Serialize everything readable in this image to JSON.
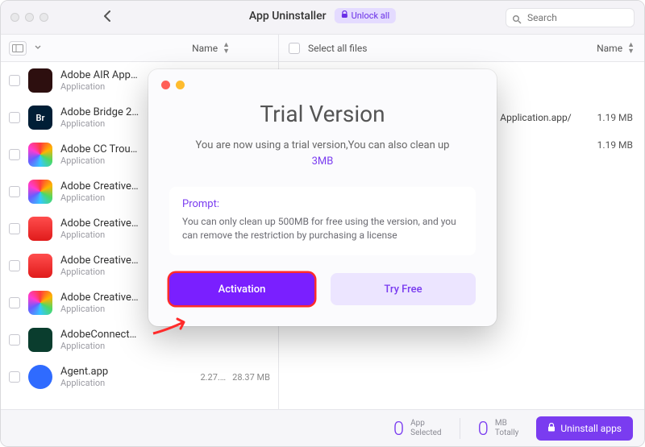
{
  "header": {
    "title": "App Uninstaller",
    "unlock_label": "Unlock all",
    "search_placeholder": "Search"
  },
  "columns": {
    "left_sort": "Name",
    "right_select_all": "Select all files",
    "right_sort": "Name"
  },
  "apps": [
    {
      "name": "Adobe AIR App…",
      "type": "Application",
      "ver": "",
      "size": "",
      "icon": "ic-dark",
      "initials": ""
    },
    {
      "name": "Adobe Bridge 2…",
      "type": "Application",
      "ver": "",
      "size": "",
      "icon": "ic-darkgrey",
      "initials": "Br"
    },
    {
      "name": "Adobe CC Trou…",
      "type": "Application",
      "ver": "",
      "size": "",
      "icon": "ic-rainbow",
      "initials": ""
    },
    {
      "name": "Adobe Creative…",
      "type": "Application",
      "ver": "",
      "size": "",
      "icon": "ic-rainbow",
      "initials": ""
    },
    {
      "name": "Adobe Creative…",
      "type": "Application",
      "ver": "",
      "size": "",
      "icon": "ic-red",
      "initials": ""
    },
    {
      "name": "Adobe Creative…",
      "type": "Application",
      "ver": "",
      "size": "",
      "icon": "ic-red",
      "initials": ""
    },
    {
      "name": "Adobe Creative…",
      "type": "Application",
      "ver": "",
      "size": "",
      "icon": "ic-rainbow",
      "initials": ""
    },
    {
      "name": "AdobeConnect…",
      "type": "Application",
      "ver": "",
      "size": "",
      "icon": "ic-green",
      "initials": ""
    },
    {
      "name": "Agent.app",
      "type": "Application",
      "ver": "2.27.…",
      "size": "28.37 MB",
      "icon": "ic-blue",
      "initials": ""
    }
  ],
  "right_items": [
    {
      "path": "Application.app/",
      "size": "1.19 MB"
    },
    {
      "path": "",
      "size": "1.19 MB"
    }
  ],
  "footer": {
    "selected_num": "0",
    "selected_l1": "App",
    "selected_l2": "Selected",
    "total_num": "0",
    "total_l1": "MB",
    "total_l2": "Totally",
    "uninstall_label": "Uninstall apps"
  },
  "modal": {
    "title": "Trial Version",
    "sub_line": "You are now using a trial version,You can also clean up",
    "sub_accent": "3MB",
    "prompt_title": "Prompt:",
    "prompt_text": "You can only clean up 500MB for free using the version, and you can remove the restriction by purchasing a license",
    "primary": "Activation",
    "secondary": "Try Free"
  }
}
